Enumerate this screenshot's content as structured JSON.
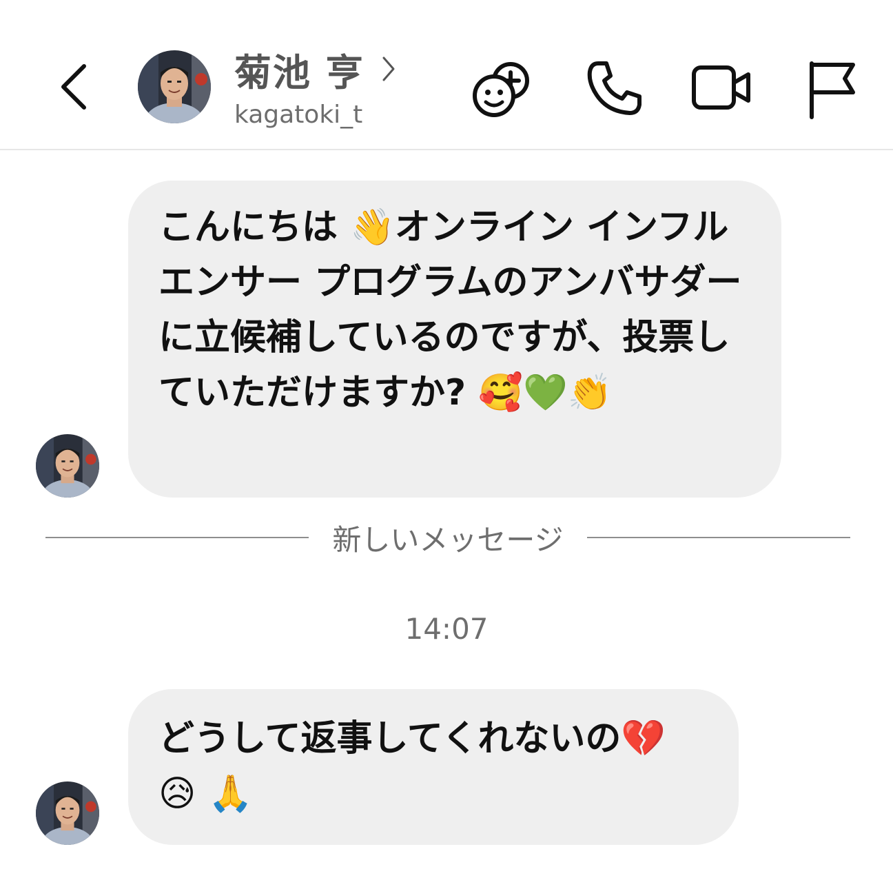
{
  "header": {
    "back_icon": "chevron-left-icon",
    "contact_name": "菊池 亨",
    "contact_username": "kagatoki_t",
    "name_chevron_icon": "chevron-right-icon",
    "actions": [
      {
        "name": "add-people-icon"
      },
      {
        "name": "phone-icon"
      },
      {
        "name": "video-camera-icon"
      },
      {
        "name": "flag-icon"
      }
    ]
  },
  "messages": [
    {
      "sender": "other",
      "text": "こんにちは 👋オンライン インフルエンサー プログラムのアンバサダーに立候補しているのですが、投票していただけますか? 🥰💚👏"
    },
    {
      "sender": "other",
      "text": "どうして返事してくれないの💔 😥 🙏"
    }
  ],
  "divider": {
    "label": "新しいメッセージ"
  },
  "timestamp": "14:07",
  "colors": {
    "bubble_bg": "#efefef",
    "divider": "#8e8e8e",
    "muted_text": "#6e6e6e"
  }
}
